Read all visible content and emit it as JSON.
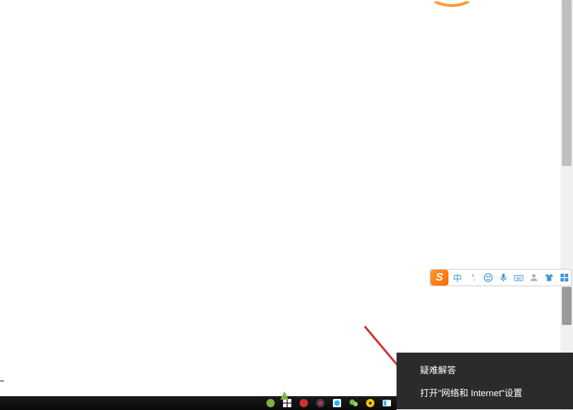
{
  "ime": {
    "logo_text": "S",
    "cn_label": "中",
    "punct_label": "°,",
    "items_order": [
      "cn",
      "punct",
      "smiley",
      "mic",
      "keyboard",
      "person",
      "shirt",
      "grid"
    ]
  },
  "context_menu": {
    "items": [
      {
        "label": "疑难解答",
        "name": "menu-item-troubleshoot"
      },
      {
        "label": "打开\"网络和 Internet\"设置",
        "name": "menu-item-network-settings"
      }
    ]
  },
  "colors": {
    "ime_accent": "#4096d8",
    "sogou_orange": "#ff7722",
    "arrow_red": "#d32f2f",
    "menu_bg": "#2b2b2b",
    "menu_text": "#ffffff"
  },
  "taskbar": {
    "icons": [
      "tray-wechat-icon",
      "tray-windows-icon",
      "tray-netease-icon",
      "tray-app-icon",
      "tray-browser-icon",
      "tray-chat-icon",
      "tray-clock-icon",
      "tray-translate-icon"
    ]
  }
}
